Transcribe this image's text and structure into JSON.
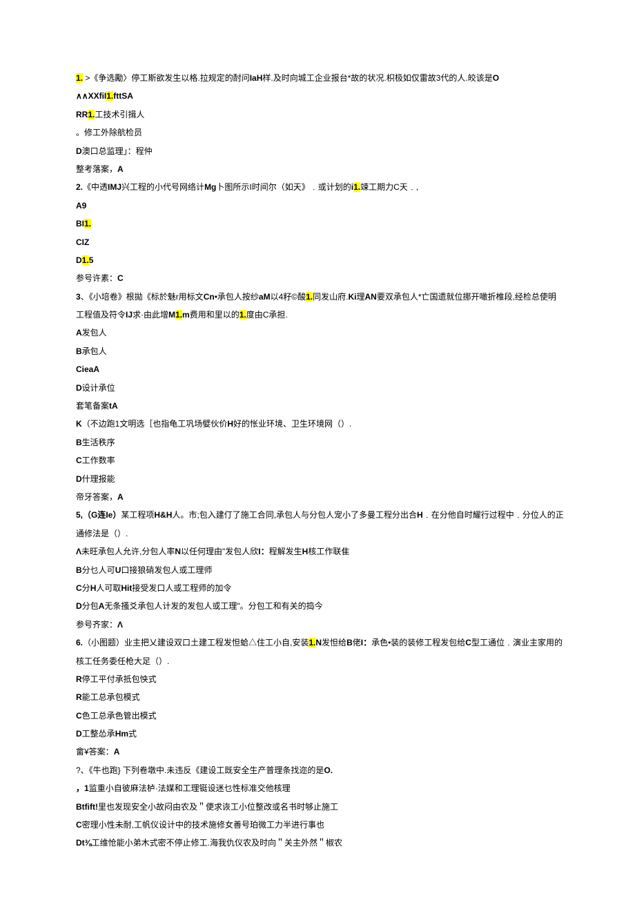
{
  "lines": [
    {
      "segments": [
        {
          "t": "1.",
          "h": true,
          "b": true
        },
        {
          "t": " >《争选勵〉停工斯欲发生以格.拉规定的酎问",
          "b": false
        },
        {
          "t": "IaH",
          "b": true
        },
        {
          "t": "样.及时向城工企业报台*故的状况.枳极如仅雷故3代的人.皎该是",
          "b": false
        },
        {
          "t": "O",
          "b": true
        }
      ]
    },
    {
      "segments": [
        {
          "t": "∧∧XXfiI",
          "b": true
        },
        {
          "t": "1.",
          "h": true,
          "b": true
        },
        {
          "t": "fttSA",
          "b": true
        }
      ]
    },
    {
      "segments": [
        {
          "t": "RR",
          "b": true
        },
        {
          "t": "1.",
          "h": true,
          "b": true
        },
        {
          "t": "工技术引揖人"
        }
      ]
    },
    {
      "segments": [
        {
          "t": "。修工外除航检员"
        }
      ]
    },
    {
      "segments": [
        {
          "t": "D",
          "b": true
        },
        {
          "t": "澳口总监理」：程仲"
        }
      ]
    },
    {
      "segments": [
        {
          "t": "整考落案，",
          "b": false
        },
        {
          "t": "A",
          "b": true
        }
      ]
    },
    {
      "segments": [
        {
          "t": "2.",
          "b": true
        },
        {
          "t": "《中透"
        },
        {
          "t": "IMJ",
          "b": true
        },
        {
          "t": "兴工程的小代号网络计"
        },
        {
          "t": "Mg",
          "b": true
        },
        {
          "t": "卜图所示I时间尔（如天》﹒或计划的"
        },
        {
          "t": "i",
          "b": true
        },
        {
          "t": "1.",
          "h": true,
          "b": true
        },
        {
          "t": "竦工期力C天﹒,"
        }
      ]
    },
    {
      "segments": [
        {
          "t": "A9",
          "b": true
        }
      ]
    },
    {
      "segments": [
        {
          "t": "BI",
          "b": true
        },
        {
          "t": "1.",
          "h": true,
          "b": true
        }
      ]
    },
    {
      "segments": [
        {
          "t": "CIZ",
          "b": true
        }
      ]
    },
    {
      "segments": [
        {
          "t": "D",
          "b": true
        },
        {
          "t": "1.",
          "h": true,
          "b": true
        },
        {
          "t": "5",
          "b": true
        }
      ]
    },
    {
      "segments": [
        {
          "t": "参号许素："
        },
        {
          "t": "C",
          "b": true
        }
      ]
    },
    {
      "segments": [
        {
          "t": "3",
          "b": true
        },
        {
          "t": "、《小培卷》根拋《标於魅r用标文"
        },
        {
          "t": "Cn",
          "b": true
        },
        {
          "t": "•承包人按纱"
        },
        {
          "t": "aM",
          "b": true
        },
        {
          "t": "以4籽©酸"
        },
        {
          "t": "1.",
          "h": true,
          "b": true
        },
        {
          "t": "同发山府."
        },
        {
          "t": "Ki",
          "b": true
        },
        {
          "t": "理"
        },
        {
          "t": "AN",
          "b": true
        },
        {
          "t": "要双承包人*亡国遗就位挪开噉折椎段,经检总使明"
        }
      ]
    },
    {
      "segments": [
        {
          "t": "工程值及符令"
        },
        {
          "t": "IJ",
          "b": true
        },
        {
          "t": "求·由此增"
        },
        {
          "t": "M",
          "b": true
        },
        {
          "t": "1.",
          "h": true,
          "b": true
        },
        {
          "t": "m",
          "b": true
        },
        {
          "t": "费用和里以的"
        },
        {
          "t": "1.",
          "h": true,
          "b": true
        },
        {
          "t": "度由C承担."
        }
      ]
    },
    {
      "segments": [
        {
          "t": "A",
          "b": true
        },
        {
          "t": "发包人"
        }
      ]
    },
    {
      "segments": [
        {
          "t": "B",
          "b": true
        },
        {
          "t": "承包人"
        }
      ]
    },
    {
      "segments": [
        {
          "t": "CieaA",
          "b": true
        }
      ]
    },
    {
      "segments": [
        {
          "t": "D",
          "b": true
        },
        {
          "t": "设计承位"
        }
      ]
    },
    {
      "segments": [
        {
          "t": "套笔备案"
        },
        {
          "t": "tA",
          "b": true
        }
      ]
    },
    {
      "segments": [
        {
          "t": "K",
          "b": true
        },
        {
          "t": "（不边跑1文明选［也指龟工巩场嬖伙价"
        },
        {
          "t": "H",
          "b": true
        },
        {
          "t": "好的怅业环境、卫生环境网（）."
        }
      ]
    },
    {
      "segments": [
        {
          "t": " "
        }
      ]
    },
    {
      "segments": [
        {
          "t": "B",
          "b": true
        },
        {
          "t": "生活秩序"
        }
      ]
    },
    {
      "segments": [
        {
          "t": "C",
          "b": true
        },
        {
          "t": "工作数率"
        }
      ]
    },
    {
      "segments": [
        {
          "t": "D",
          "b": true
        },
        {
          "t": "什理报能"
        }
      ]
    },
    {
      "segments": [
        {
          "t": "帝牙答案，"
        },
        {
          "t": "A",
          "b": true
        }
      ]
    },
    {
      "segments": [
        {
          "t": "5,（G连Ie）",
          "b": true
        },
        {
          "t": "某工程项"
        },
        {
          "t": "H&H",
          "b": true
        },
        {
          "t": "人。市;包入建仃了施工合同,承包人与分包人宠小了多曼工程分出合"
        },
        {
          "t": "H",
          "b": true
        },
        {
          "t": "﹒在分他自时耀行过程中﹒分位人的正"
        }
      ]
    },
    {
      "segments": [
        {
          "t": "通修法是（）."
        }
      ]
    },
    {
      "segments": [
        {
          "t": "Λ",
          "b": true
        },
        {
          "t": "未旺承包人允许,分包人率"
        },
        {
          "t": "N",
          "b": true
        },
        {
          "t": "以任何理由\"发包人欣"
        },
        {
          "t": "I：",
          "b": true
        },
        {
          "t": "程解发生"
        },
        {
          "t": "H",
          "b": true
        },
        {
          "t": "核工作联隹"
        }
      ]
    },
    {
      "segments": [
        {
          "t": "B",
          "b": true
        },
        {
          "t": "分乜人可"
        },
        {
          "t": "U",
          "b": true
        },
        {
          "t": "口接狼硝发包人或工理师"
        }
      ]
    },
    {
      "segments": [
        {
          "t": "C",
          "b": true
        },
        {
          "t": "分"
        },
        {
          "t": "H",
          "b": true
        },
        {
          "t": "人可取"
        },
        {
          "t": "Hit",
          "b": true
        },
        {
          "t": "接受发口人或工程师的加令"
        }
      ]
    },
    {
      "segments": [
        {
          "t": "D",
          "b": true
        },
        {
          "t": "分包"
        },
        {
          "t": "A",
          "b": true
        },
        {
          "t": "无条搔爻承包人计发的发包人或工理\"。分包工和有关的捣今"
        }
      ]
    },
    {
      "segments": [
        {
          "t": "参号齐家："
        },
        {
          "t": "Λ",
          "b": true
        }
      ]
    },
    {
      "segments": [
        {
          "t": "6.",
          "b": true
        },
        {
          "t": "（小图题）业主把乂建设双口土建工程发怛蛤△住工小自,安装"
        },
        {
          "t": "1.",
          "h": true,
          "b": true
        },
        {
          "t": "N",
          "b": true
        },
        {
          "t": "发怛给"
        },
        {
          "t": "B",
          "b": true
        },
        {
          "t": "佬"
        },
        {
          "t": "I：",
          "b": true
        },
        {
          "t": "承色•装的装修工程发包给"
        },
        {
          "t": "C",
          "b": true
        },
        {
          "t": "型工通位﹒演业主家用的"
        }
      ]
    },
    {
      "segments": [
        {
          "t": "核工任务委任枪大足（）."
        }
      ]
    },
    {
      "segments": [
        {
          "t": "R",
          "b": true
        },
        {
          "t": "停工平付承抵包怏式"
        }
      ]
    },
    {
      "segments": [
        {
          "t": "R",
          "b": true
        },
        {
          "t": "能工总承包模式"
        }
      ]
    },
    {
      "segments": [
        {
          "t": "C",
          "b": true
        },
        {
          "t": "色工总承色管出模式"
        }
      ]
    },
    {
      "segments": [
        {
          "t": "D",
          "b": true
        },
        {
          "t": "工整怂承"
        },
        {
          "t": "Hm",
          "b": true
        },
        {
          "t": "式"
        }
      ]
    },
    {
      "segments": [
        {
          "t": "畲¥答案："
        },
        {
          "t": "A",
          "b": true
        }
      ]
    },
    {
      "segments": [
        {
          "t": "?、《牛也跑} 下列卷墩中.未违反《建设工既安全生产普理条找迩的是"
        },
        {
          "t": "O.",
          "b": true
        }
      ]
    },
    {
      "segments": [
        {
          "t": "，1",
          "b": true
        },
        {
          "t": "监重小自彼麻法栌·法媒和工理铤设迷乜性标准交他核理"
        }
      ]
    },
    {
      "segments": [
        {
          "t": "Btfift!",
          "b": true
        },
        {
          "t": "里也发现安全小故闷由农及＂便求诙工小位整改或名书时够止施工"
        }
      ]
    },
    {
      "segments": [
        {
          "t": "C",
          "b": true
        },
        {
          "t": "密理小性未耐,工帆仪设计中的技术施修女善号珀微工力半进行事也"
        }
      ]
    },
    {
      "segments": [
        {
          "t": "Dt⅜",
          "b": true
        },
        {
          "t": "工维怆能小弟木式密不停止修工.海我仇仪农及时向＂关主外然＂椒农"
        }
      ]
    }
  ]
}
